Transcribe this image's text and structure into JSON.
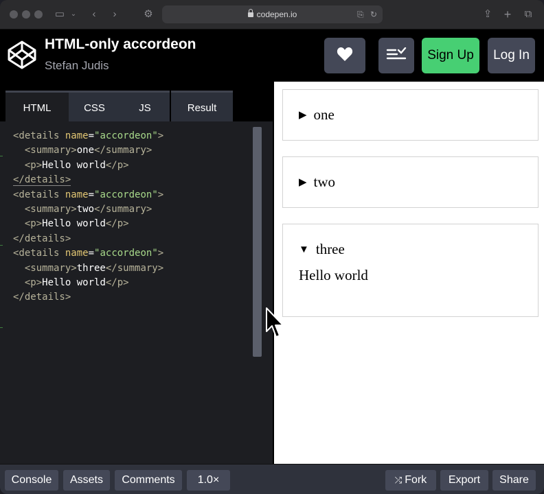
{
  "browser": {
    "url": "codepen.io"
  },
  "header": {
    "title": "HTML-only accordeon",
    "author": "Stefan Judis",
    "sign_up_label": "Sign Up",
    "log_in_label": "Log In"
  },
  "editor": {
    "tabs": [
      {
        "label": "HTML"
      },
      {
        "label": "CSS"
      },
      {
        "label": "JS"
      },
      {
        "label": "Result"
      }
    ]
  },
  "code": {
    "tag_details_open": "<details",
    "attr_name": "name",
    "eq": "=",
    "value": "\"accordeon\"",
    "gt": ">",
    "summary_open": "<summary>",
    "summary_close": "</summary>",
    "p_open": "<p>",
    "p_close": "</p>",
    "details_close": "</details>",
    "line_text_hello": "Hello world",
    "summaries": [
      "one",
      "two",
      "three"
    ]
  },
  "result": {
    "items": [
      {
        "summary": "one",
        "open": false,
        "marker": "▶"
      },
      {
        "summary": "two",
        "open": false,
        "marker": "▶"
      },
      {
        "summary": "three",
        "open": true,
        "marker": "▼",
        "content": "Hello world"
      }
    ]
  },
  "footer": {
    "console_label": "Console",
    "assets_label": "Assets",
    "comments_label": "Comments",
    "zoom_label": "1.0×",
    "fork_label": "Fork",
    "export_label": "Export",
    "share_label": "Share"
  },
  "colors": {
    "accent_green": "#47cf73",
    "button_gray": "#444857"
  }
}
